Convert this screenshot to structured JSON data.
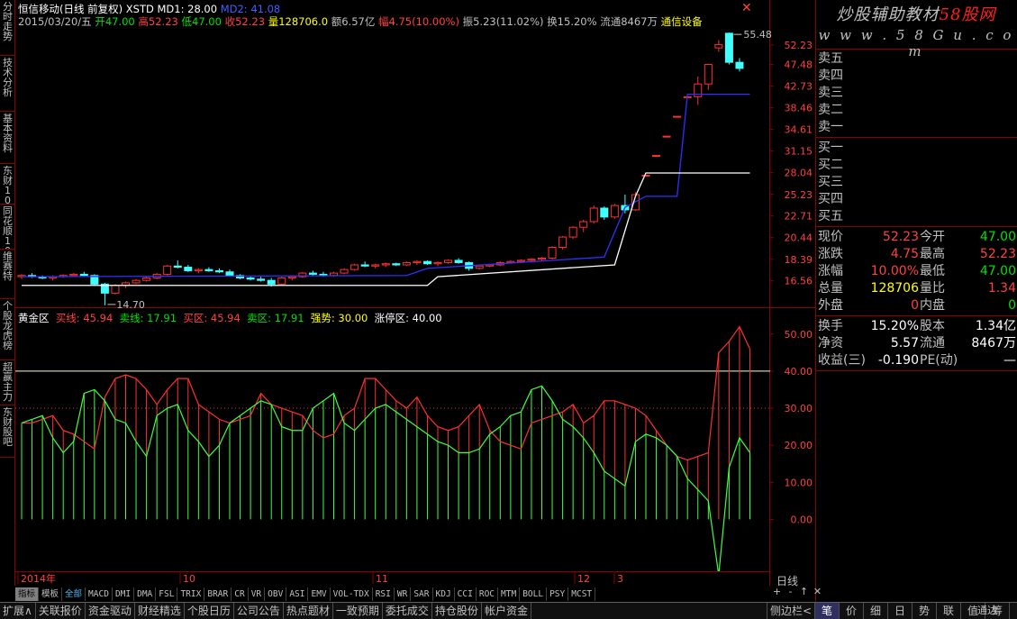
{
  "left_tabs": [
    "分时走势",
    "技术分析",
    "基本资料",
    "东财10",
    "同花顺10",
    "维赛特",
    "个股龙虎榜",
    "超赢主力",
    "东财股吧"
  ],
  "header": {
    "title": "恒信移动(日线 前复权) XSTD",
    "md1_label": "MD1: 28.00",
    "md2_label": "MD2: 41.08",
    "date": "2015/03/20/五",
    "open": "开47.00",
    "high": "高52.23",
    "low": "低47.00",
    "close": "收52.23",
    "volume": "量128706.0",
    "amount": "额6.57亿",
    "change_pct": "幅4.75(10.00%)",
    "amplitude": "振5.23(11.02%)",
    "turnover": "换15.20%",
    "float": "流通8467万",
    "sector": "通信设备",
    "close_btn": "✕"
  },
  "indicator": {
    "name": "黄金区",
    "buy_line": "买线: 45.94",
    "sell_line": "卖线: 17.91",
    "buy_zone": "买区: 45.94",
    "sell_zone": "卖区: 17.91",
    "strength": "强势: 30.00",
    "limit_zone": "涨停区: 40.00"
  },
  "watermark": {
    "line1": "炒股辅助教材",
    "line1_red": "58股网",
    "line2": "w w w . 5 8 G u . c o m"
  },
  "order_book": {
    "sell": [
      "卖五",
      "卖四",
      "卖三",
      "卖二",
      "卖一"
    ],
    "buy": [
      "买一",
      "买二",
      "买三",
      "买四",
      "买五"
    ]
  },
  "quote": [
    {
      "l1": "现价",
      "v1": "52.23",
      "c1": "#ff4040",
      "l2": "今开",
      "v2": "47.00",
      "c2": "#00e000"
    },
    {
      "l1": "涨跌",
      "v1": "4.75",
      "c1": "#ff4040",
      "l2": "最高",
      "v2": "52.23",
      "c2": "#ff4040"
    },
    {
      "l1": "涨幅",
      "v1": "10.00%",
      "c1": "#ff4040",
      "l2": "最低",
      "v2": "47.00",
      "c2": "#00e000"
    },
    {
      "l1": "总量",
      "v1": "128706",
      "c1": "#ffff00",
      "l2": "量比",
      "v2": "1.34",
      "c2": "#ff4040"
    },
    {
      "l1": "外盘",
      "v1": "0",
      "c1": "#ff4040",
      "l2": "内盘",
      "v2": "0",
      "c2": "#00e000"
    }
  ],
  "stats": [
    {
      "l1": "换手",
      "v1": "15.20%",
      "l2": "股本",
      "v2": "1.34亿"
    },
    {
      "l1": "净资",
      "v1": "5.57",
      "l2": "流通",
      "v2": "8467万"
    },
    {
      "l1": "收益(三)",
      "v1": "-0.190",
      "l2": "PE(动)",
      "v2": "—"
    }
  ],
  "indicator_tabs": [
    "指标",
    "模板",
    "全部",
    "MACD",
    "DMI",
    "DMA",
    "FSL",
    "TRIX",
    "BRAR",
    "CR",
    "VR",
    "OBV",
    "ASI",
    "EMV",
    "VOL-TDX",
    "RSI",
    "WR",
    "SAR",
    "KDJ",
    "CCI",
    "ROC",
    "MTM",
    "BOLL",
    "PSY",
    "MCST"
  ],
  "bottom_tabs": [
    "扩展∧",
    "关联报价",
    "资金驱动",
    "财经精选",
    "个股日历",
    "公司公告",
    "热点题材",
    "一致预期",
    "委托成交",
    "持仓股份",
    "帐户资金"
  ],
  "right_bottom_tabs": [
    "笔",
    "价",
    "细",
    "日",
    "势",
    "联",
    "值",
    "筹"
  ],
  "right_bottom_extra": "通达",
  "side_controls": [
    "+",
    "-",
    "↑",
    "✕"
  ],
  "side_label": "侧边栏<",
  "period": "日线",
  "colors": {
    "up": "#ff3030",
    "down": "#40ffff",
    "frame": "#8b0000",
    "md1": "#ffffff",
    "md2": "#3030ff",
    "buy_line": "#ff3030",
    "sell_line": "#40ff40"
  },
  "chart_data": [
    {
      "type": "candlestick",
      "title": "恒信移动(日线 前复权)",
      "y_ticks": [
        16.56,
        18.39,
        20.44,
        22.71,
        25.23,
        28.04,
        31.15,
        34.61,
        38.46,
        42.73,
        47.48,
        52.23
      ],
      "ylim": [
        14.5,
        57.0
      ],
      "log_scale": true,
      "x_labels": [
        "2014年",
        "10",
        "11",
        "12",
        "3"
      ],
      "annotations": [
        {
          "text": "55.48"
        },
        {
          "text": "14.70"
        }
      ],
      "n_bars": 70,
      "candles": [
        [
          16.9,
          17.1,
          16.7,
          17.0
        ],
        [
          17.0,
          17.2,
          16.8,
          16.9
        ],
        [
          16.9,
          17.0,
          16.7,
          16.8
        ],
        [
          16.8,
          17.0,
          16.6,
          16.9
        ],
        [
          16.9,
          17.1,
          16.8,
          17.0
        ],
        [
          17.0,
          17.2,
          16.9,
          17.1
        ],
        [
          17.1,
          17.3,
          16.9,
          17.0
        ],
        [
          17.0,
          17.1,
          16.2,
          16.3
        ],
        [
          16.3,
          16.4,
          14.7,
          15.6
        ],
        [
          15.6,
          16.3,
          15.5,
          16.2
        ],
        [
          16.2,
          16.5,
          16.0,
          16.4
        ],
        [
          16.4,
          16.7,
          16.3,
          16.6
        ],
        [
          16.6,
          16.9,
          16.5,
          16.8
        ],
        [
          16.8,
          17.2,
          16.7,
          17.1
        ],
        [
          17.1,
          17.9,
          17.0,
          17.8
        ],
        [
          17.8,
          18.3,
          17.6,
          17.7
        ],
        [
          17.7,
          17.9,
          17.3,
          17.4
        ],
        [
          17.4,
          17.6,
          17.2,
          17.5
        ],
        [
          17.5,
          17.7,
          17.3,
          17.4
        ],
        [
          17.4,
          17.6,
          17.2,
          17.3
        ],
        [
          17.3,
          17.5,
          16.9,
          17.0
        ],
        [
          17.0,
          17.1,
          16.7,
          16.8
        ],
        [
          16.8,
          16.9,
          16.6,
          16.7
        ],
        [
          16.7,
          16.9,
          16.5,
          16.6
        ],
        [
          16.6,
          16.8,
          16.1,
          16.3
        ],
        [
          16.3,
          16.9,
          16.2,
          16.8
        ],
        [
          16.8,
          17.0,
          16.6,
          16.9
        ],
        [
          16.9,
          17.3,
          16.8,
          17.2
        ],
        [
          17.2,
          17.4,
          17.0,
          17.1
        ],
        [
          17.1,
          17.3,
          16.9,
          17.0
        ],
        [
          17.0,
          17.3,
          16.9,
          17.2
        ],
        [
          17.2,
          17.6,
          17.1,
          17.5
        ],
        [
          17.5,
          18.0,
          17.4,
          17.9
        ],
        [
          17.9,
          18.2,
          17.7,
          17.8
        ],
        [
          17.8,
          18.0,
          17.6,
          17.9
        ],
        [
          17.9,
          18.1,
          17.7,
          18.0
        ],
        [
          18.0,
          18.1,
          17.8,
          17.9
        ],
        [
          17.9,
          18.2,
          17.8,
          18.1
        ],
        [
          18.1,
          18.3,
          17.9,
          18.2
        ],
        [
          18.2,
          18.3,
          17.9,
          18.0
        ],
        [
          18.0,
          18.2,
          17.8,
          18.1
        ],
        [
          18.1,
          18.4,
          18.0,
          18.3
        ],
        [
          18.3,
          18.5,
          18.0,
          18.1
        ],
        [
          18.1,
          18.2,
          17.4,
          17.6
        ],
        [
          17.6,
          17.9,
          17.5,
          17.8
        ],
        [
          17.8,
          18.0,
          17.7,
          17.9
        ],
        [
          17.9,
          18.2,
          17.8,
          18.1
        ],
        [
          18.1,
          18.3,
          18.0,
          18.2
        ],
        [
          18.2,
          18.4,
          18.1,
          18.3
        ],
        [
          18.3,
          18.5,
          18.1,
          18.4
        ],
        [
          18.4,
          18.6,
          18.2,
          18.5
        ],
        [
          18.5,
          19.6,
          18.4,
          19.5
        ],
        [
          19.5,
          20.6,
          19.3,
          20.5
        ],
        [
          20.5,
          21.6,
          20.3,
          21.5
        ],
        [
          21.5,
          22.3,
          21.0,
          22.1
        ],
        [
          22.1,
          23.9,
          21.9,
          23.6
        ],
        [
          23.6,
          23.8,
          22.3,
          22.6
        ],
        [
          22.6,
          24.1,
          22.4,
          23.9
        ],
        [
          23.9,
          25.2,
          23.0,
          23.4
        ],
        [
          23.4,
          25.5,
          23.3,
          25.2
        ],
        [
          27.7,
          27.7,
          27.7,
          27.7
        ],
        [
          30.5,
          30.5,
          30.5,
          30.5
        ],
        [
          33.5,
          33.5,
          33.5,
          33.5
        ],
        [
          36.9,
          36.9,
          36.9,
          36.9
        ],
        [
          40.6,
          40.6,
          40.6,
          40.6
        ],
        [
          40.6,
          44.8,
          39.0,
          43.2
        ],
        [
          43.2,
          47.6,
          42.0,
          47.5
        ],
        [
          51.5,
          53.5,
          50.5,
          52.3
        ],
        [
          55.3,
          55.48,
          47.5,
          48.0
        ],
        [
          48.0,
          49.0,
          45.9,
          46.6
        ]
      ],
      "md1": [
        [
          0,
          16.2
        ],
        [
          39,
          16.2
        ],
        [
          40,
          16.9
        ],
        [
          57,
          17.9
        ],
        [
          59,
          25.0
        ],
        [
          60,
          28.0
        ],
        [
          70,
          28.0
        ]
      ],
      "md2": [
        [
          0,
          16.9
        ],
        [
          37,
          17.0
        ],
        [
          39,
          17.6
        ],
        [
          56,
          18.6
        ],
        [
          58,
          23.7
        ],
        [
          60,
          25.0
        ],
        [
          63,
          25.0
        ],
        [
          64,
          41.08
        ],
        [
          70,
          41.08
        ]
      ]
    },
    {
      "type": "line",
      "title": "黄金区",
      "ylim": [
        -14,
        57
      ],
      "y_ticks": [
        0.0,
        10.0,
        20.0,
        30.0,
        40.0,
        50.0
      ],
      "reference_lines": [
        {
          "value": 40.0,
          "name": "涨停区"
        },
        {
          "value": 30.0,
          "name": "强势"
        }
      ],
      "series": [
        {
          "name": "买线",
          "values": [
            26,
            26,
            27,
            28,
            24,
            23,
            21,
            19,
            33,
            38,
            39,
            38,
            35,
            31,
            35,
            38,
            38,
            31,
            29,
            27,
            26,
            27,
            28,
            34,
            31,
            30,
            29,
            28,
            24,
            22,
            23,
            28,
            30,
            38,
            38,
            35,
            32,
            30,
            33,
            28,
            25,
            24,
            25,
            28,
            31,
            24,
            21,
            20,
            19,
            26,
            27,
            28,
            29,
            31,
            26,
            28,
            32,
            32,
            31,
            30,
            28,
            24,
            20,
            17,
            16,
            17,
            18,
            45,
            48,
            52,
            46
          ]
        },
        {
          "name": "卖线",
          "values": [
            26,
            27,
            28,
            22,
            18,
            21,
            34,
            35,
            32,
            27,
            26,
            21,
            17,
            28,
            30,
            31,
            24,
            21,
            17,
            20,
            26,
            28,
            30,
            32,
            31,
            25,
            24,
            24,
            30,
            32,
            34,
            26,
            24,
            27,
            30,
            31,
            29,
            27,
            25,
            23,
            21,
            20,
            18,
            18,
            19,
            23,
            25,
            28,
            29,
            35,
            36,
            32,
            27,
            25,
            22,
            18,
            13,
            11,
            9,
            21,
            23,
            22,
            20,
            17,
            11,
            8,
            5,
            -15,
            14,
            22,
            18
          ]
        }
      ]
    }
  ]
}
